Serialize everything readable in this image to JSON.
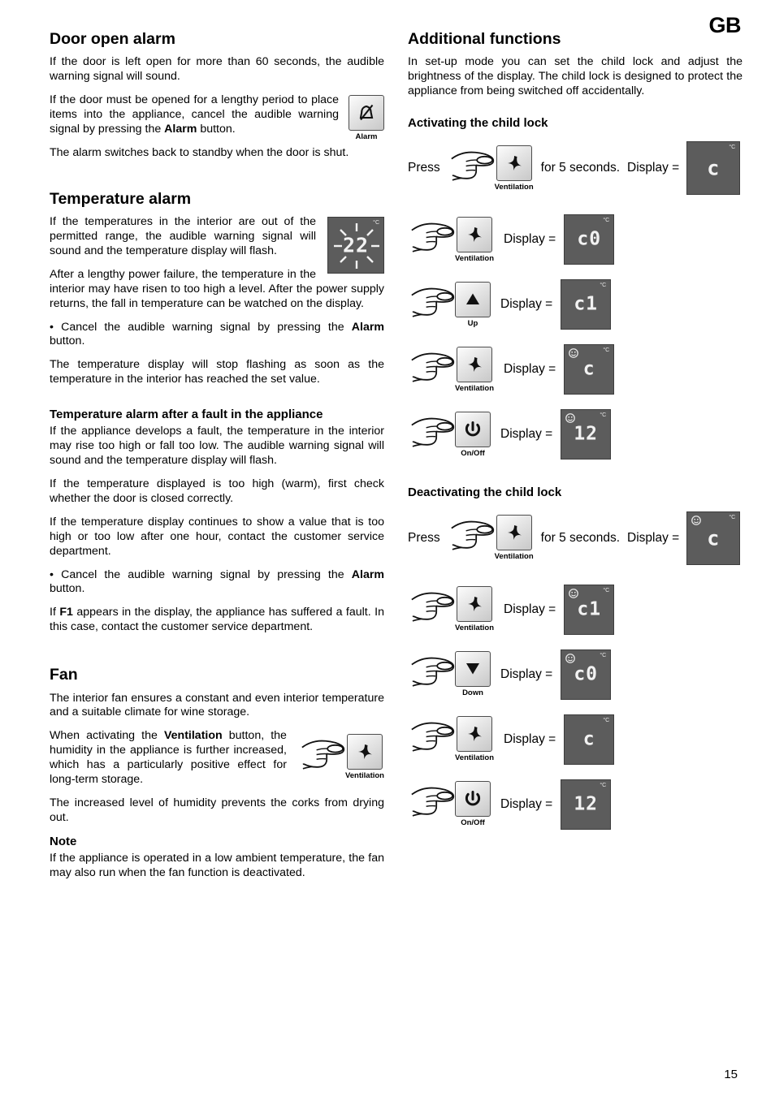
{
  "header": {
    "language_tag": "GB"
  },
  "footer": {
    "page_number": "15"
  },
  "left_column": {
    "door_alarm": {
      "heading": "Door open alarm",
      "p1": "If the door is left open for more than 60 seconds, the audible warning signal will sound.",
      "p2_a": "If the door must be opened for a lengthy period to place items into the appliance, cancel the audible warning signal by pressing the ",
      "p2_bold": "Alarm",
      "p2_b": " button.",
      "p3": "The alarm switches back to standby when the door is shut.",
      "button_label": "Alarm",
      "button_icon": "alarm-off-icon"
    },
    "temperature_alarm": {
      "heading": "Temperature alarm",
      "p1": "If the temperatures in the interior are out of the permitted range, the audible warning signal will sound and the temperature display will flash.",
      "p2": "After a lengthy power failure, the temperature in the interior may have risen to too high a level. After the power supply returns, the fall in temperature can be watched on the display.",
      "bullet_a": "• Cancel the audible warning signal by pressing the ",
      "bullet_bold": "Alarm",
      "bullet_b": " button.",
      "p3": "The temperature display will stop flashing as soon as the temperature in the interior has reached the set value.",
      "display_value": "22",
      "display_unit": "°C",
      "display_state": "flashing"
    },
    "fault_alarm": {
      "heading": "Temperature alarm after a fault in the appliance",
      "p1": "If the appliance develops a fault, the temperature in the interior may rise too high or fall too low. The audible warning signal will sound and the temperature display will flash.",
      "p2": "If the temperature displayed is too high (warm), first check whether the door is closed correctly.",
      "p3": "If the temperature display continues to show a value that is too high or too low after one hour, contact the customer service department.",
      "bullet_a": "• Cancel the audible warning signal by pressing the ",
      "bullet_bold": "Alarm",
      "bullet_b": " button.",
      "p4_a": "If ",
      "p4_bold": "F1",
      "p4_b": " appears in the display, the appliance has suffered a fault. In this case, contact the customer service department."
    },
    "fan": {
      "heading": "Fan",
      "p1": "The interior fan ensures a constant and even interior temperature and a suitable climate for wine storage.",
      "p2_a": "When activating the ",
      "p2_bold": "Ventilation",
      "p2_b": " button, the humidity in the appliance is further increased, which has a particularly positive effect for long-term storage.",
      "p3": "The increased level of humidity prevents the corks from drying out.",
      "note_heading": "Note",
      "note_text": "If the appliance is operated in a low ambient temperature, the fan may also run when the fan function is deactivated.",
      "button_label": "Ventilation",
      "button_icon": "fan-icon"
    }
  },
  "right_column": {
    "heading": "Additional functions",
    "intro": "In set-up mode you can set the child lock and adjust the brightness of the display. The child lock is designed to protect the appliance from being switched off accidentally.",
    "activating": {
      "heading": "Activating the child lock",
      "press_prefix": "Press",
      "press_suffix": "for 5 seconds.",
      "display_eq": "Display =",
      "press_button_label": "Ventilation",
      "press_button_icon": "fan-icon",
      "press_display": {
        "value": "c",
        "unit": "°C",
        "child_lock": false
      },
      "steps": [
        {
          "button_label": "Ventilation",
          "button_icon": "fan-icon",
          "display_eq": "Display =",
          "display": {
            "value": "c0",
            "unit": "°C",
            "child_lock": false
          }
        },
        {
          "button_label": "Up",
          "button_icon": "arrow-up-icon",
          "display_eq": "Display =",
          "display": {
            "value": "c1",
            "unit": "°C",
            "child_lock": false
          }
        },
        {
          "button_label": "Ventilation",
          "button_icon": "fan-icon",
          "display_eq": "Display =",
          "display": {
            "value": "c",
            "unit": "°C",
            "child_lock": true
          }
        },
        {
          "button_label": "On/Off",
          "button_icon": "power-icon",
          "display_eq": "Display =",
          "display": {
            "value": "12",
            "unit": "°C",
            "child_lock": true
          }
        }
      ]
    },
    "deactivating": {
      "heading": "Deactivating the child lock",
      "press_prefix": "Press",
      "press_suffix": "for 5 seconds.",
      "display_eq": "Display =",
      "press_button_label": "Ventilation",
      "press_button_icon": "fan-icon",
      "press_display": {
        "value": "c",
        "unit": "°C",
        "child_lock": true
      },
      "steps": [
        {
          "button_label": "Ventilation",
          "button_icon": "fan-icon",
          "display_eq": "Display =",
          "display": {
            "value": "c1",
            "unit": "°C",
            "child_lock": true
          }
        },
        {
          "button_label": "Down",
          "button_icon": "arrow-down-icon",
          "display_eq": "Display =",
          "display": {
            "value": "c0",
            "unit": "°C",
            "child_lock": true
          }
        },
        {
          "button_label": "Ventilation",
          "button_icon": "fan-icon",
          "display_eq": "Display =",
          "display": {
            "value": "c",
            "unit": "°C",
            "child_lock": false
          }
        },
        {
          "button_label": "On/Off",
          "button_icon": "power-icon",
          "display_eq": "Display =",
          "display": {
            "value": "12",
            "unit": "°C",
            "child_lock": false
          }
        }
      ]
    }
  }
}
